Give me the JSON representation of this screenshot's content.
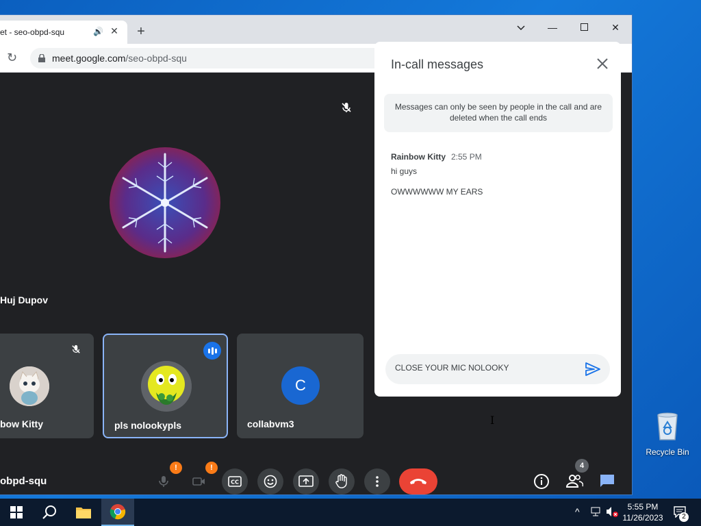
{
  "browser": {
    "tab_title": "et - seo-obpd-squ",
    "new_tab": "+",
    "url_host": "meet.google.com",
    "url_path": "/seo-obpd-squ"
  },
  "meet": {
    "main_participant": "Huj Dupov",
    "tiles": [
      {
        "name": "bow Kitty"
      },
      {
        "name": "pls nolookypls"
      },
      {
        "name": "collabvm3",
        "initial": "C"
      }
    ],
    "meeting_code": "obpd-squ",
    "warn_mark": "!",
    "people_count": "4"
  },
  "chat": {
    "title": "In-call messages",
    "notice": "Messages can only be seen by people in the call and are deleted when the call ends",
    "sender": "Rainbow Kitty",
    "time": "2:55 PM",
    "messages": [
      "hi guys",
      "OWWWWWW MY EARS"
    ],
    "input_value": "CLOSE YOUR MIC NOLOOKY"
  },
  "desktop": {
    "recycle_bin_label": "Recycle Bin"
  },
  "taskbar": {
    "time": "5:55 PM",
    "date": "11/26/2023",
    "notification_count": "2"
  },
  "colors": {
    "end_call": "#ea4335",
    "accent_blue": "#8ab4f8",
    "warning": "#fa7b17"
  }
}
